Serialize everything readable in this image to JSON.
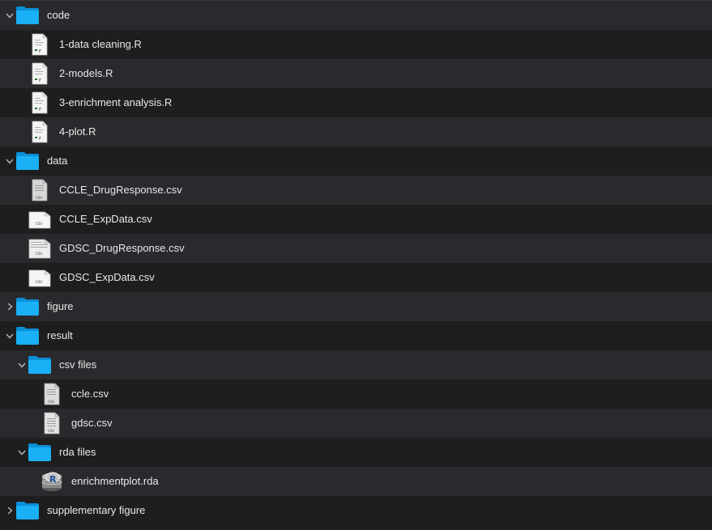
{
  "tree": [
    {
      "label": "code",
      "type": "folder",
      "expanded": true
    },
    {
      "label": "1-data cleaning.R",
      "type": "r-file"
    },
    {
      "label": "2-models.R",
      "type": "r-file"
    },
    {
      "label": "3-enrichment analysis.R",
      "type": "r-file"
    },
    {
      "label": "4-plot.R",
      "type": "r-file"
    },
    {
      "label": "data",
      "type": "folder",
      "expanded": true
    },
    {
      "label": "CCLE_DrugResponse.csv",
      "type": "csv-file",
      "tag": "CSV"
    },
    {
      "label": "CCLE_ExpData.csv",
      "type": "csv-file",
      "tag": "CSV"
    },
    {
      "label": "GDSC_DrugResponse.csv",
      "type": "csv-file",
      "tag": "CSV"
    },
    {
      "label": "GDSC_ExpData.csv",
      "type": "csv-file",
      "tag": "CSV"
    },
    {
      "label": "figure",
      "type": "folder",
      "expanded": false
    },
    {
      "label": "result",
      "type": "folder",
      "expanded": true
    },
    {
      "label": "csv files",
      "type": "folder",
      "expanded": true
    },
    {
      "label": "ccle.csv",
      "type": "csv-file",
      "tag": "CSV"
    },
    {
      "label": "gdsc.csv",
      "type": "csv-file",
      "tag": "CSV"
    },
    {
      "label": "rda files",
      "type": "folder",
      "expanded": true
    },
    {
      "label": "enrichmentplot.rda",
      "type": "rda-file"
    },
    {
      "label": "supplementary figure",
      "type": "folder",
      "expanded": false
    }
  ],
  "colors": {
    "folder": "#1ab0f5",
    "folder_dark": "#0a8fd6",
    "row_alt": "#2a2a2e",
    "background": "#1e1e1e"
  }
}
